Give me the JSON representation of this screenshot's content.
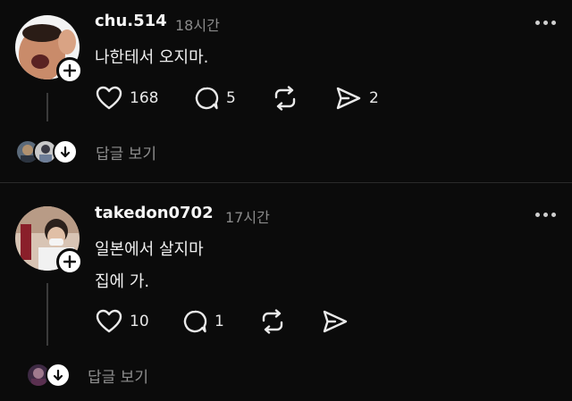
{
  "posts": [
    {
      "username": "chu.514",
      "time": "18시간",
      "lines": [
        "나한테서 오지마."
      ],
      "likes": "168",
      "comments": "5",
      "shares": "2",
      "view_replies": "답글 보기"
    },
    {
      "username": "takedon0702",
      "time": "17시간",
      "lines": [
        "일본에서 살지마",
        "집에 가."
      ],
      "likes": "10",
      "comments": "1",
      "view_replies": "답글 보기"
    }
  ],
  "icons": {
    "like": "heart-icon",
    "comment": "comment-bubble-icon",
    "repost": "repost-icon",
    "share": "send-icon",
    "more": "more-dots-icon",
    "follow": "plus-icon",
    "expand": "arrow-down-icon"
  },
  "colors": {
    "background": "#0b0b0b",
    "text": "#f2f2f2",
    "muted": "#8a8a8a",
    "divider": "#2a2a2a"
  }
}
